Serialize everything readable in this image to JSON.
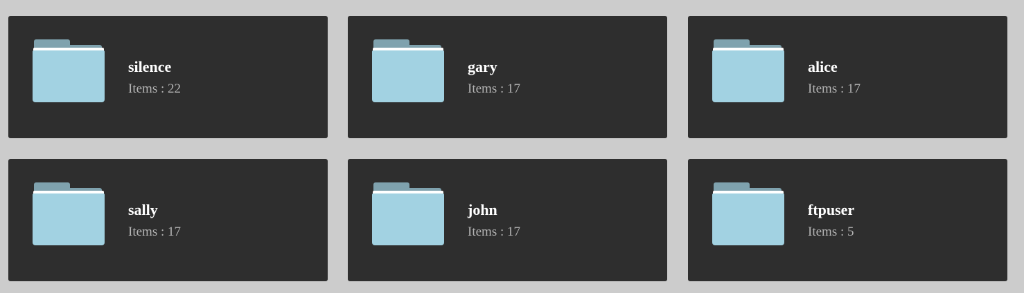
{
  "folders": [
    {
      "name": "silence",
      "items_label": "Items : 22"
    },
    {
      "name": "gary",
      "items_label": "Items : 17"
    },
    {
      "name": "alice",
      "items_label": "Items : 17"
    },
    {
      "name": "sally",
      "items_label": "Items : 17"
    },
    {
      "name": "john",
      "items_label": "Items : 17"
    },
    {
      "name": "ftpuser",
      "items_label": "Items : 5"
    }
  ],
  "colors": {
    "page_background": "#cccccc",
    "card_background": "#2e2e2e",
    "folder_front": "#a2d2e2",
    "folder_back": "#7fa2ae",
    "name_text": "#ffffff",
    "count_text": "#b4b4b4"
  }
}
